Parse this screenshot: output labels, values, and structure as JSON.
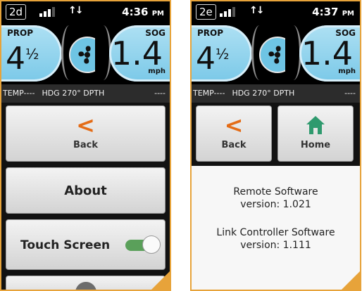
{
  "screens": [
    {
      "label": "2d",
      "time": "4:36",
      "time_suffix": "PM",
      "prop": {
        "label": "PROP",
        "whole": "4",
        "fraction": "½"
      },
      "sog": {
        "label": "SOG",
        "value": "1.4",
        "unit": "mph"
      },
      "info": {
        "temp": "TEMP----",
        "hdg": "HDG 270° DPTH",
        "trailing": "----"
      },
      "buttons": {
        "back": "Back",
        "about": "About",
        "touch_screen": "Touch Screen"
      },
      "touch_screen_enabled": true
    },
    {
      "label": "2e",
      "time": "4:37",
      "time_suffix": "PM",
      "prop": {
        "label": "PROP",
        "whole": "4",
        "fraction": "½"
      },
      "sog": {
        "label": "SOG",
        "value": "1.4",
        "unit": "mph"
      },
      "info": {
        "temp": "TEMP----",
        "hdg": "HDG 270° DPTH",
        "trailing": "----"
      },
      "buttons": {
        "back": "Back",
        "home": "Home"
      },
      "remote_software_label": "Remote Software",
      "remote_software_version": "version: 1.021",
      "link_controller_label": "Link Controller Software",
      "link_controller_version": "version: 1.111"
    }
  ],
  "colors": {
    "accent_frame": "#e7a33a",
    "back_icon": "#e46c16",
    "home_icon": "#2f9a6e",
    "gauge_blue": "#7bc9e8",
    "toggle_on": "#5aa05a"
  },
  "icons": {
    "back": "chevron-left-icon",
    "home": "home-icon",
    "propeller": "propeller-icon",
    "more": "chevron-down-icon",
    "signal": "signal-icon",
    "link": "up-down-arrows-icon"
  }
}
